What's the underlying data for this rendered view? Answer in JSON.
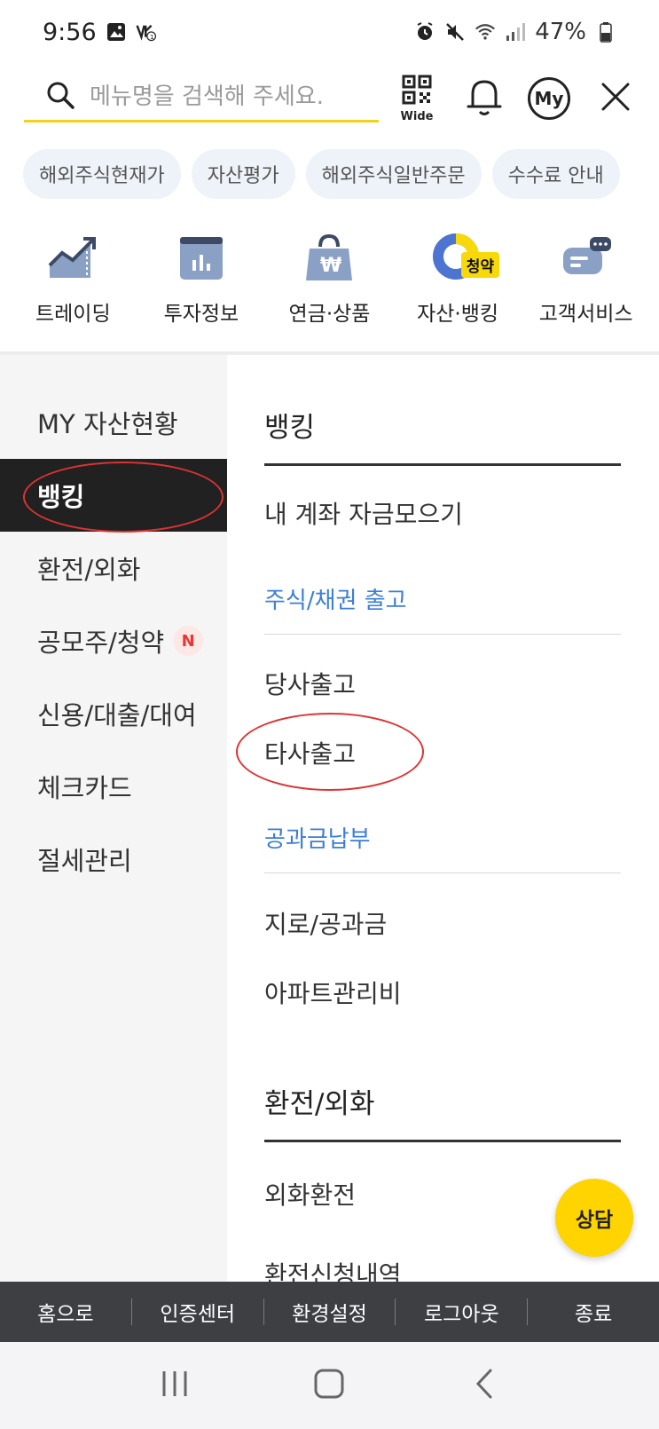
{
  "status_bar": {
    "time": "9:56",
    "battery": "47%",
    "left_icons": [
      "image-icon",
      "app-notification-icon"
    ],
    "right_icons": [
      "alarm-icon",
      "mute-icon",
      "wifi-icon",
      "signal-icon",
      "battery-icon"
    ]
  },
  "search": {
    "placeholder": "메뉴명을 검색해 주세요.",
    "qr_label": "Wide",
    "my_label": "My"
  },
  "chips": [
    "해외주식현재가",
    "자산평가",
    "해외주식일반주문",
    "수수료 안내"
  ],
  "categories": [
    {
      "label": "트레이딩",
      "icon": "chart-trend-icon"
    },
    {
      "label": "투자정보",
      "icon": "report-icon"
    },
    {
      "label": "연금·상품",
      "icon": "bag-won-icon"
    },
    {
      "label": "자산·뱅킹",
      "icon": "donut-chart-icon",
      "badge": "청약"
    },
    {
      "label": "고객서비스",
      "icon": "chat-bubble-icon"
    }
  ],
  "left_nav": [
    {
      "label": "MY 자산현황"
    },
    {
      "label": "뱅킹",
      "active": true
    },
    {
      "label": "환전/외화"
    },
    {
      "label": "공모주/청약",
      "badge": "N"
    },
    {
      "label": "신용/대출/대여"
    },
    {
      "label": "체크카드"
    },
    {
      "label": "절세관리"
    }
  ],
  "content": {
    "banking_title": "뱅킹",
    "link_collect": "내 계좌 자금모으기",
    "stock_bond_head": "주식/채권 출고",
    "link_our": "당사출고",
    "link_other": "타사출고",
    "utility_head": "공과금납부",
    "link_giro": "지로/공과금",
    "link_apt": "아파트관리비",
    "fx_title": "환전/외화",
    "link_fx": "외화환전",
    "link_fx_history": "환전신청내역"
  },
  "float_button": "상담",
  "bottom_bar": [
    "홈으로",
    "인증센터",
    "환경설정",
    "로그아웃",
    "종료"
  ],
  "colors": {
    "accent_yellow": "#f2d31b",
    "active_nav_bg": "#212121",
    "link_blue": "#3b7ed6",
    "annotation_red": "#d33333",
    "bottom_bar_bg": "#3d3f43"
  }
}
